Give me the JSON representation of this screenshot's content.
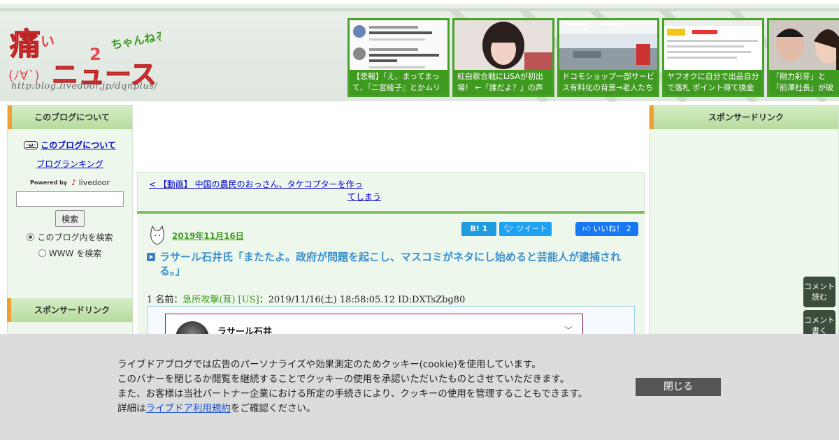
{
  "header": {
    "logo_alt": "痛いニュース",
    "logo_sub": "ちゃんねる",
    "logo_url": "http:blog.livedoor.jp/dqnplus/",
    "thumbs": [
      {
        "caption": "【悲報】「え、まってまって、『二宮綾子』とかムリ"
      },
      {
        "caption": "紅白歌合戦にLiSAが初出場！ ←「誰だよ？」の声"
      },
      {
        "caption": "ドコモショップ一部サービス有料化の背景→老人たち"
      },
      {
        "caption": "ヤフオクに自分で出品自分で落札 ポイント得て換金"
      },
      {
        "caption": "「剛力彩芽」と「前澤社長」が破局"
      }
    ]
  },
  "left": {
    "section_title": "このブログについて",
    "about_link": "このブログについて",
    "ranking_link": "ブログランキング",
    "powered_by": "Powered by",
    "livedoor": "livedoor",
    "search_button": "検索",
    "radio_blog": "このブログ内を検索",
    "radio_www": "WWW を検索",
    "sponsor_title": "スポンサードリンク"
  },
  "right": {
    "sponsor_title": "スポンサードリンク"
  },
  "main": {
    "prev_link_line1": "< 【動画】 中国の農民のおっさん、タケコプターを作っ",
    "prev_link_line2": "てしまう",
    "date": "2019年11月16日",
    "hatena_label": "B! 1",
    "tweet_label": "ツイート",
    "like_label": "いいね！ 2",
    "title": "ラサール石井氏「またたよ。政府が問題を起こし、マスコミがネタにし始めると芸能人が逮捕される。」",
    "res_prefix": "1 名前：",
    "res_name": "急所攻撃(茸) [US]",
    "res_meta": "：2019/11/16(土) 18:58:05.12 ID:DXTsZbg80",
    "tweet_name": "ラサール石井"
  },
  "side_buttons": {
    "read": "コメント読む",
    "write": "コメント書く"
  },
  "cookie": {
    "line1": "ライブドアブログでは広告のパーソナライズや効果測定のためクッキー(cookie)を使用しています。",
    "line2": "このバナーを閉じるか閲覧を継続することでクッキーの使用を承認いただいたものとさせていただきます。",
    "line3": "また、お客様は当社パートナー企業における所定の手続きにより、クッキーの使用を管理することもできます。",
    "line4_prefix": "詳細は",
    "line4_link": "ライブドア利用規約",
    "line4_suffix": "をご確認ください。",
    "close": "閉じる"
  }
}
